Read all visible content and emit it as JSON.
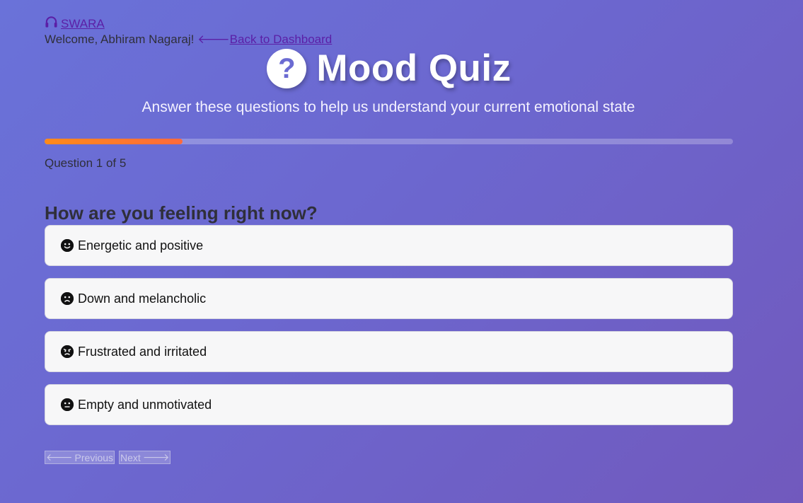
{
  "header": {
    "brand": "SWARA",
    "welcome": "Welcome, Abhiram Nagaraj!",
    "back_link": "Back to Dashboard"
  },
  "quiz": {
    "title": "Mood Quiz",
    "subtitle": "Answer these questions to help us understand your current emotional state",
    "progress": 0.2,
    "question_count": "Question 1 of 5",
    "question": "How are you feeling right now?",
    "options": [
      {
        "icon": "smiling-face-icon",
        "label": "Energetic and positive"
      },
      {
        "icon": "sad-face-icon",
        "label": "Down and melancholic"
      },
      {
        "icon": "angry-face-icon",
        "label": "Frustrated and irritated"
      },
      {
        "icon": "neutral-face-icon",
        "label": "Empty and unmotivated"
      }
    ]
  },
  "nav": {
    "previous": "Previous",
    "next": "Next"
  },
  "colors": {
    "accent_progress": "#ff7a2a",
    "link": "#5b1fa6",
    "background_start": "#6a72d9",
    "background_end": "#7159bd"
  }
}
